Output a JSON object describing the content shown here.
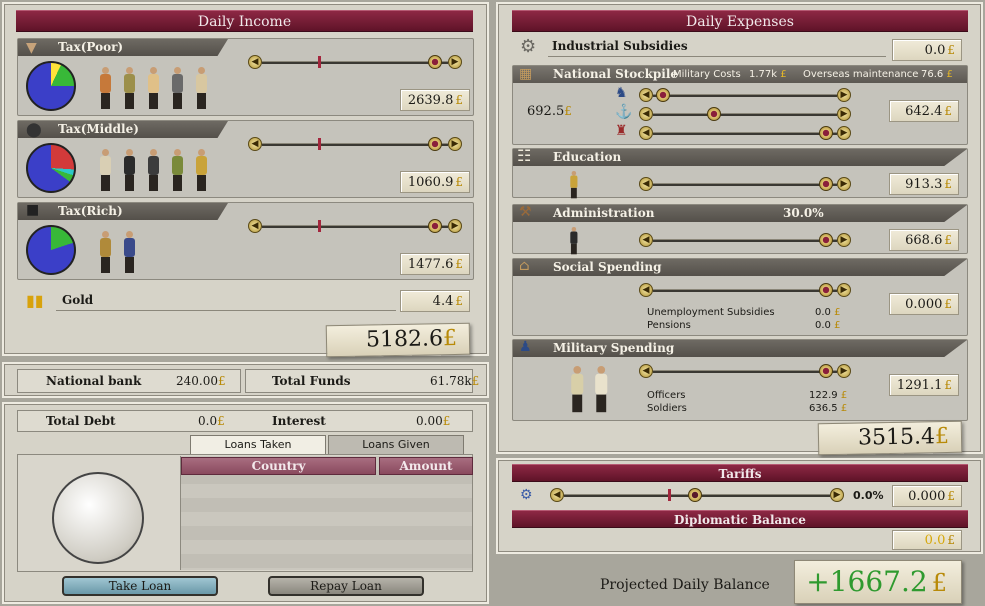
{
  "income": {
    "title": "Daily Income",
    "poor": {
      "label": "Tax(Poor)",
      "value": "2639.8"
    },
    "middle": {
      "label": "Tax(Middle)",
      "value": "1060.9"
    },
    "rich": {
      "label": "Tax(Rich)",
      "value": "1477.6"
    },
    "gold": {
      "label": "Gold",
      "value": "4.4"
    },
    "total": "5182.6"
  },
  "bank": {
    "national_bank_label": "National bank",
    "national_bank_value": "240.00",
    "total_funds_label": "Total Funds",
    "total_funds_value": "61.78k"
  },
  "debt": {
    "total_debt_label": "Total Debt",
    "total_debt_value": "0.0",
    "interest_label": "Interest",
    "interest_value": "0.00",
    "tab_taken": "Loans Taken",
    "tab_given": "Loans Given",
    "col_country": "Country",
    "col_amount": "Amount",
    "take_loan": "Take Loan",
    "repay_loan": "Repay Loan"
  },
  "expenses": {
    "title": "Daily Expenses",
    "industrial": {
      "label": "Industrial Subsidies",
      "value": "0.0"
    },
    "stockpile": {
      "label": "National Stockpile",
      "military_costs_label": "Military Costs",
      "military_costs_value": "1.77k",
      "overseas_label": "Overseas maintenance",
      "overseas_value": "76.6",
      "left_value": "692.5",
      "value": "642.4"
    },
    "education": {
      "label": "Education",
      "value": "913.3"
    },
    "administration": {
      "label": "Administration",
      "percent": "30.0%",
      "value": "668.6"
    },
    "social": {
      "label": "Social Spending",
      "unemployment_label": "Unemployment Subsidies",
      "unemployment_value": "0.0",
      "pensions_label": "Pensions",
      "pensions_value": "0.0",
      "value": "0.000"
    },
    "military": {
      "label": "Military Spending",
      "officers_label": "Officers",
      "officers_value": "122.9",
      "soldiers_label": "Soldiers",
      "soldiers_value": "636.5",
      "value": "1291.1"
    },
    "total": "3515.4"
  },
  "tariffs": {
    "title": "Tariffs",
    "percent": "0.0%",
    "value": "0.000"
  },
  "diplomatic": {
    "title": "Diplomatic Balance",
    "value": "0.0"
  },
  "balance": {
    "label": "Projected Daily Balance",
    "value": "+1667.2"
  },
  "currency": "£",
  "colors": {
    "accent": "#7a1c36",
    "positive": "#2f9a2f",
    "pie_blue": "#3b3fc8",
    "pie_green": "#38b838",
    "pie_red": "#d23a3a"
  }
}
